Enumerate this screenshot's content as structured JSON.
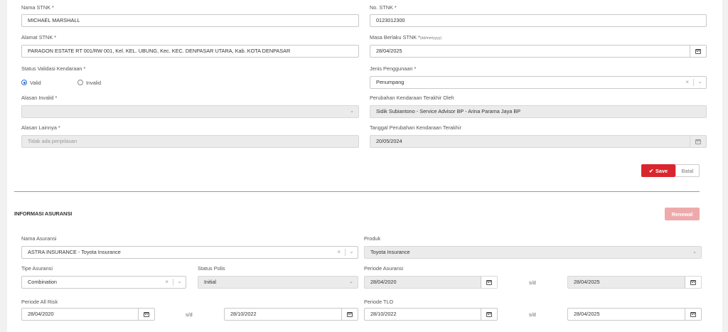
{
  "vehicle": {
    "nama_stnk": {
      "label": "Nama STNK",
      "value": "MICHAEL MARSHALL"
    },
    "no_stnk": {
      "label": "No. STNK",
      "value": "0123012300"
    },
    "alamat_stnk": {
      "label": "Alamat STNK",
      "value": "PARAGON ESTATE RT 001/RW 001, Kel. KEL. UBUNG, Kec. KEC. DENPASAR UTARA, Kab. KOTA DENPASAR"
    },
    "masa_berlaku": {
      "label": "Masa Berlaku STNK",
      "note": "(dd/mm/yyyy)",
      "value": "28/04/2025"
    },
    "status_validasi": {
      "label": "Status Validasi Kendaraan",
      "options": [
        "Valid",
        "Invalid"
      ],
      "selected": "Valid"
    },
    "jenis_penggunaan": {
      "label": "Jenis Penggunaan",
      "value": "Penumpang"
    },
    "alasan_invalid": {
      "label": "Alasan Invalid",
      "value": ""
    },
    "perubahan_oleh": {
      "label": "Perubahan Kendaraan Terakhir Oleh",
      "value": "Sidik Subiantono - Service Advisor BP - Arina Parama Jaya BP"
    },
    "alasan_lainnya": {
      "label": "Alasan Lainnya",
      "placeholder": "Tidak ada penjelasan"
    },
    "tanggal_perubahan": {
      "label": "Tanggal Perubahan Kendaraan Terakhir",
      "value": "20/05/2024"
    },
    "save_label": "Save",
    "batal_label": "Batal"
  },
  "insurance": {
    "title": "INFORMASI ASURANSI",
    "renewal_label": "Renewal",
    "nama_asuransi": {
      "label": "Nama Asuransi",
      "value": "ASTRA INSURANCE - Toyota Insurance"
    },
    "produk": {
      "label": "Produk",
      "value": "Toyota Insurance"
    },
    "tipe_asuransi": {
      "label": "Tipe Asuransi",
      "value": "Combination"
    },
    "status_polis": {
      "label": "Status Polis",
      "value": "Initial"
    },
    "periode_asuransi": {
      "label": "Periode Asuransi",
      "start": "28/04/2020",
      "end": "28/04/2025"
    },
    "periode_all_risk": {
      "label": "Periode All Risk",
      "start": "28/04/2020",
      "end": "28/10/2022"
    },
    "periode_tlo": {
      "label": "Periode TLO",
      "start": "28/10/2022",
      "end": "28/04/2025"
    },
    "sd_label": "s/d"
  },
  "icons": {
    "calendar": "calendar-icon",
    "chevron": "chevron-down-icon",
    "clear": "clear-icon",
    "check": "check-icon"
  },
  "colors": {
    "primary_red": "#d9262e",
    "renewal_disabled": "#eeaaab",
    "radio_blue": "#2a72d8"
  }
}
